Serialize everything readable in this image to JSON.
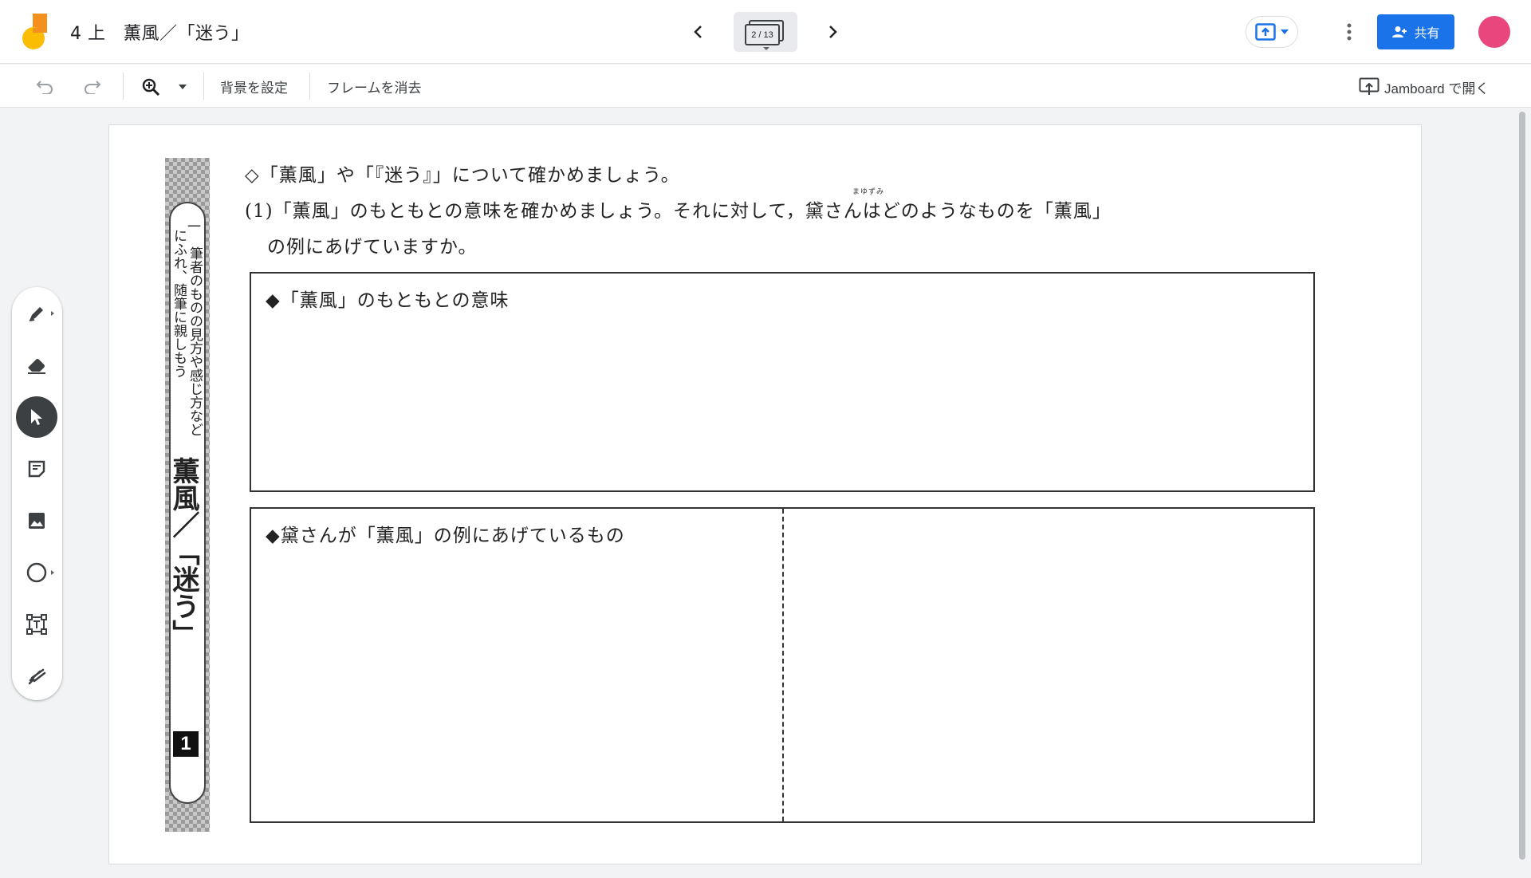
{
  "app": {
    "doc_title": "4 上　薫風／「迷う」",
    "frame_counter": "2 / 13",
    "share_label": "共有",
    "colors": {
      "accent": "#1a73e8",
      "avatar": "#e8467c",
      "logo_orange": "#f4901e",
      "logo_yellow": "#fbbc04"
    }
  },
  "toolbar": {
    "set_background": "背景を設定",
    "clear_frame": "フレームを消去",
    "open_in_jamboard": "Jamboard で開く",
    "icons": [
      "undo-icon",
      "redo-icon",
      "zoom-in-icon",
      "chevron-down-icon",
      "open-in-jamboard-icon"
    ]
  },
  "palette": {
    "tools": [
      "pen-icon",
      "eraser-icon",
      "select-icon",
      "sticky-note-icon",
      "image-icon",
      "circle-icon",
      "text-box-icon",
      "laser-icon"
    ],
    "active_tool": "select-icon"
  },
  "worksheet": {
    "side": {
      "goal_number": "一",
      "goal_line1": "筆者のものの見方や感じ方など",
      "goal_line2": "にふれ、随筆に親しもう",
      "unit_title": "薫風／「迷う」",
      "unit_number": "1"
    },
    "intro": "◇「薫風」や「『迷う』」について確かめましょう。",
    "q1_line1": "(1)「薫風」のもともとの意味を確かめましょう。それに対して，黛さんはどのようなものを「薫風」",
    "q1_line2": "の例にあげていますか。",
    "ruby": "まゆずみ",
    "box1_label": "◆「薫風」のもともとの意味",
    "box2_label": "◆黛さんが「薫風」の例にあげているもの"
  }
}
